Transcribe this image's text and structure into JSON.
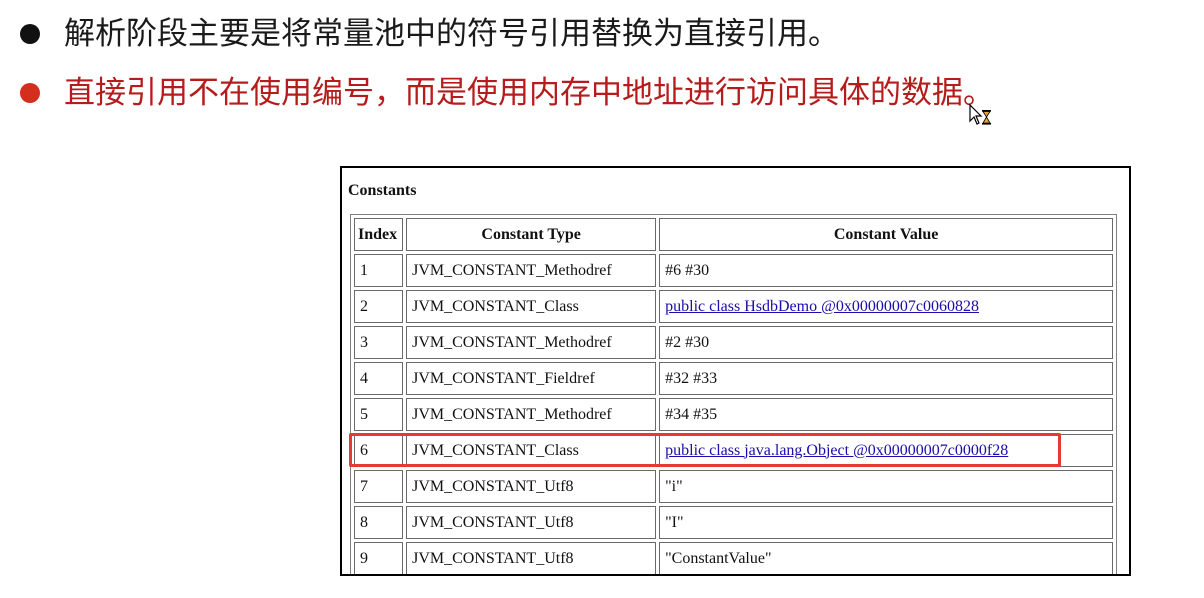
{
  "bullets": [
    {
      "text": "解析阶段主要是将常量池中的符号引用替换为直接引用。",
      "dot_color": "#111111",
      "text_color": "#1a1a1a"
    },
    {
      "text": "直接引用不在使用编号，而是使用内存中地址进行访问具体的数据。",
      "dot_color": "#d32f1e",
      "text_color": "#b71c1c"
    }
  ],
  "cursor_icon": "busy-arrow-cursor-icon",
  "highlight_color": "#e53935",
  "constants": {
    "title": "Constants",
    "headers": {
      "index": "Index",
      "type": "Constant Type",
      "value": "Constant Value"
    },
    "rows": [
      {
        "index": "1",
        "type": "JVM_CONSTANT_Methodref",
        "value": "#6 #30",
        "link": false
      },
      {
        "index": "2",
        "type": "JVM_CONSTANT_Class",
        "value": "public class HsdbDemo @0x00000007c0060828",
        "link": true
      },
      {
        "index": "3",
        "type": "JVM_CONSTANT_Methodref",
        "value": "#2 #30",
        "link": false
      },
      {
        "index": "4",
        "type": "JVM_CONSTANT_Fieldref",
        "value": "#32 #33",
        "link": false
      },
      {
        "index": "5",
        "type": "JVM_CONSTANT_Methodref",
        "value": "#34 #35",
        "link": false
      },
      {
        "index": "6",
        "type": "JVM_CONSTANT_Class",
        "value": "public class java.lang.Object @0x00000007c0000f28",
        "link": true,
        "highlighted": true
      },
      {
        "index": "7",
        "type": "JVM_CONSTANT_Utf8",
        "value": "\"i\"",
        "link": false
      },
      {
        "index": "8",
        "type": "JVM_CONSTANT_Utf8",
        "value": "\"I\"",
        "link": false
      },
      {
        "index": "9",
        "type": "JVM_CONSTANT_Utf8",
        "value": "\"ConstantValue\"",
        "link": false
      }
    ]
  }
}
